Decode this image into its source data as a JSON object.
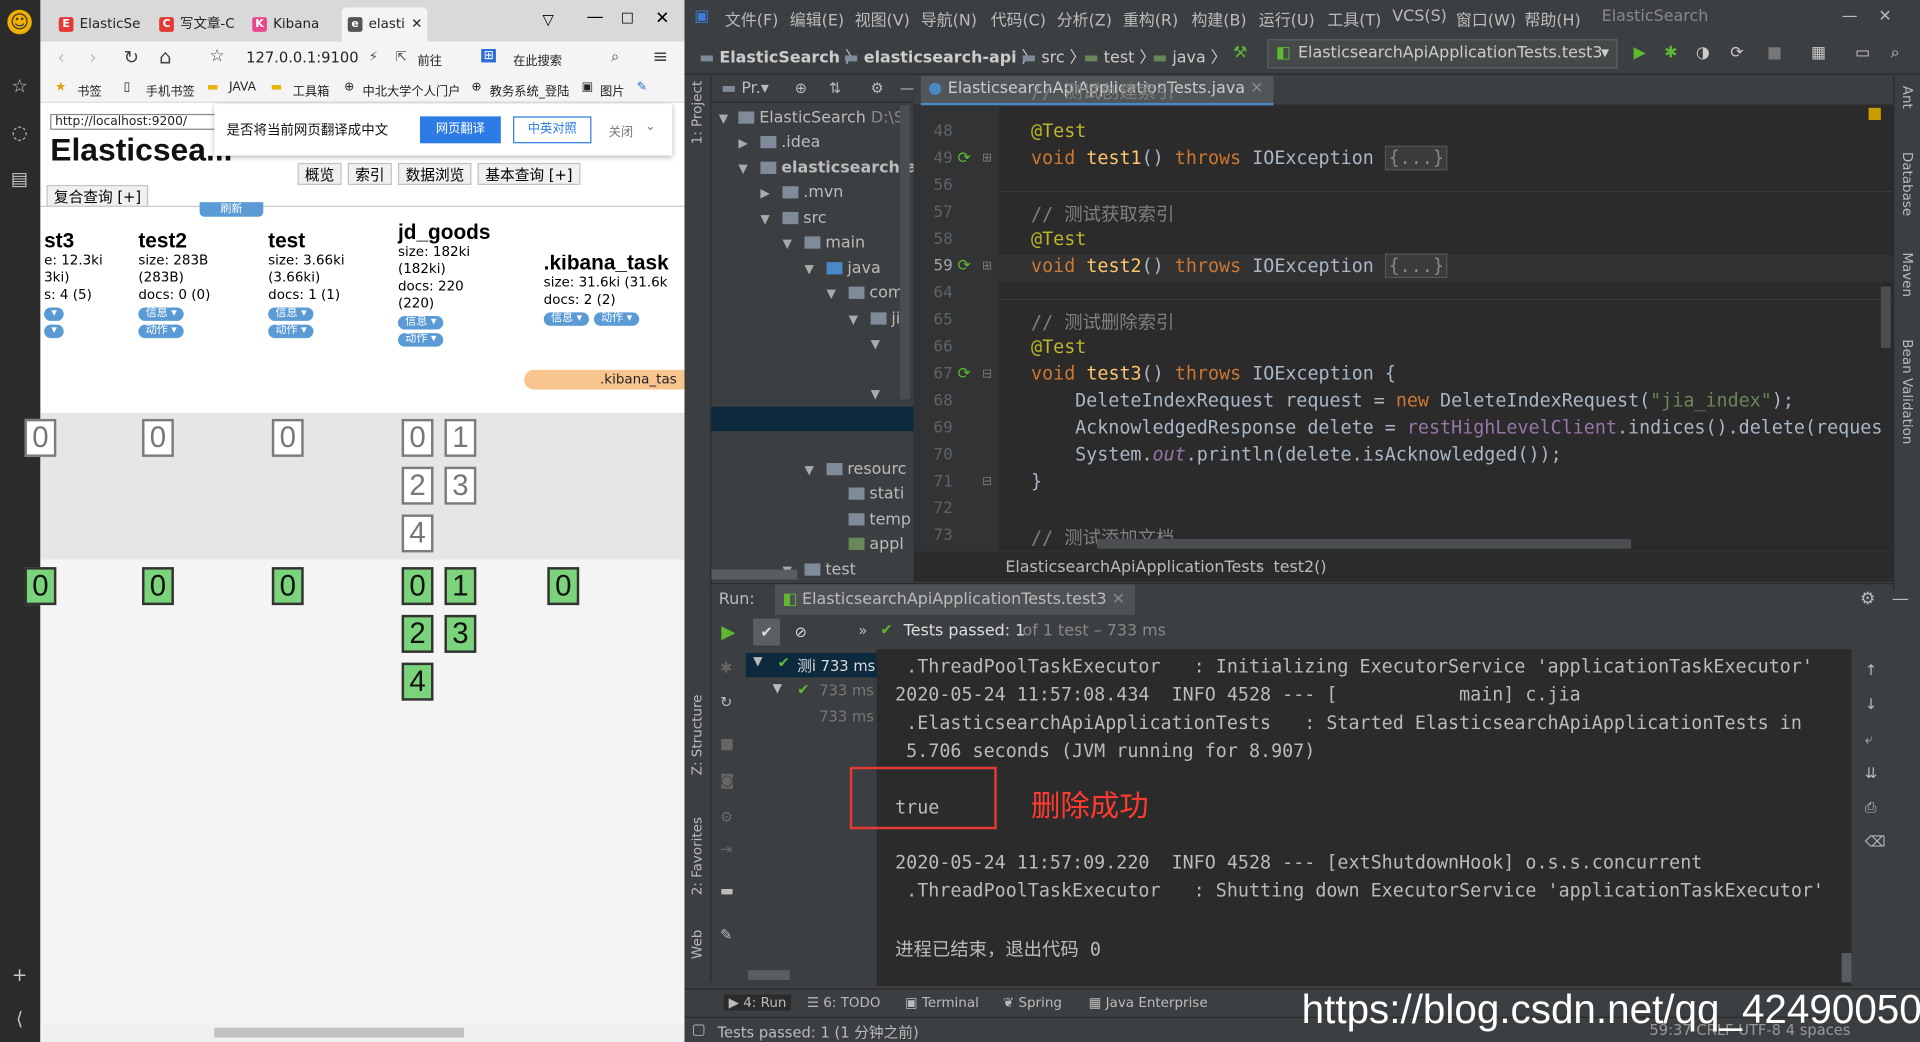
{
  "browser": {
    "tabs": [
      "ElasticSe",
      "写文章-C",
      "Kibana",
      "elasti"
    ],
    "address": "127.0.0.1:9100",
    "nav_extra": [
      "前往",
      "在此搜索"
    ],
    "bookmarks": [
      "书签",
      "手机书签",
      "JAVA",
      "工具箱",
      "中北大学个人门户",
      "教务系统_登陆",
      "图片"
    ],
    "translate": {
      "url": "http://localhost:9200/",
      "prompt": "是否将当前网页翻译成中文",
      "translate_btn": "网页翻译",
      "compare_btn": "中英对照",
      "close_btn": "关闭"
    },
    "title": "Elasticsea...",
    "tabs2": [
      "概览",
      "索引",
      "数据浏览",
      "基本查询 [+]"
    ],
    "compound_query": "复合查询 [+]",
    "refresh": "刷新",
    "indices": [
      {
        "name": "st3",
        "l1": "e: 12.3ki",
        "l2": "3ki)",
        "l3": "s: 4 (5)",
        "l4": ""
      },
      {
        "name": "test2",
        "l1": "size: 283B",
        "l2": "(283B)",
        "l3": "docs: 0 (0)",
        "l4": ""
      },
      {
        "name": "test",
        "l1": "size: 3.66ki",
        "l2": "(3.66ki)",
        "l3": "docs: 1 (1)",
        "l4": ""
      },
      {
        "name": "jd_goods",
        "l1": "size: 182ki",
        "l2": "(182ki)",
        "l3": "docs: 220",
        "l4": "(220)"
      },
      {
        "name": ".kibana_task",
        "l1": "size: 31.6ki (31.6k",
        "l2": "docs: 2 (2)",
        "l3": "",
        "l4": ""
      }
    ],
    "pill_info": "信息",
    "pill_action": "动作",
    "alias": ".kibana_tas",
    "shard_nums": [
      "0",
      "1",
      "2",
      "3",
      "4"
    ]
  },
  "ide": {
    "menu": [
      "文件(F)",
      "编辑(E)",
      "视图(V)",
      "导航(N)",
      "代码(C)",
      "分析(Z)",
      "重构(R)",
      "构建(B)",
      "运行(U)",
      "工具(T)",
      "VCS(S)",
      "窗口(W)",
      "帮助(H)",
      "ElasticSearch"
    ],
    "crumbs": [
      "ElasticSearch",
      "elasticsearch-api",
      "src",
      "test",
      "java"
    ],
    "run_config": "ElasticsearchApiApplicationTests.test3",
    "project_label": "Pr.",
    "project_tree": [
      {
        "label": "ElasticSearch",
        "extra": "D:\\S"
      },
      {
        "label": ".idea"
      },
      {
        "label": "elasticsearch-ap"
      },
      {
        "label": ".mvn"
      },
      {
        "label": "src"
      },
      {
        "label": "main"
      },
      {
        "label": "java"
      },
      {
        "label": "com"
      },
      {
        "label": "ji"
      },
      {
        "label": "resourc"
      },
      {
        "label": "stati"
      },
      {
        "label": "temp"
      },
      {
        "label": "appl"
      },
      {
        "label": "test"
      }
    ],
    "editor_tab": "ElasticsearchApiApplicationTests.java",
    "line_numbers": [
      "48",
      "49",
      "56",
      "57",
      "58",
      "59",
      "64",
      "65",
      "66",
      "67",
      "68",
      "69",
      "70",
      "71",
      "72",
      "73"
    ],
    "code": {
      "c1": "// 测试创建索引",
      "ann": "@Test",
      "void": "void",
      "t1": "test1",
      "t2": "test2",
      "t3": "test3",
      "throws": "throws",
      "ioe": "IOException",
      "folded": "{...}",
      "c2": "// 测试获取索引",
      "c3": "// 测试删除索引",
      "open": "{",
      "l68a": "DeleteIndexRequest request = ",
      "new": "new",
      "l68b": " DeleteIndexRequest(",
      "l68s": "\"jia_index\"",
      "l68c": ");",
      "l69a": "AcknowledgedResponse delete = ",
      "l69f": "restHighLevelClient",
      "l69b": ".indices().delete(reques",
      "l70a": "System.",
      "l70o": "out",
      "l70b": ".println(delete.isAcknowledged());",
      "close": "}",
      "c4": "// 测试添加文档"
    },
    "crumb_class": "ElasticsearchApiApplicationTests",
    "crumb_method": "test2()",
    "run_label": "Run:",
    "run_tab": "ElasticsearchApiApplicationTests.test3",
    "tests_passed": "Tests passed: 1",
    "tests_of": "of 1 test – 733 ms",
    "tree_node": "测i 733 ms",
    "tree_sub": "733 ms",
    "tree_sub2": "733 ms",
    "console": [
      " .ThreadPoolTaskExecutor   : Initializing ExecutorService 'applicationTaskExecutor'",
      "2020-05-24 11:57:08.434  INFO 4528 --- [           main] c.jia",
      " .ElasticsearchApiApplicationTests   : Started ElasticsearchApiApplicationTests in",
      " 5.706 seconds (JVM running for 8.907)",
      "true",
      "2020-05-24 11:57:09.220  INFO 4528 --- [extShutdownHook] o.s.s.concurrent",
      " .ThreadPoolTaskExecutor   : Shutting down ExecutorService 'applicationTaskExecutor'",
      "进程已结束，退出代码 0"
    ],
    "annotation": "删除成功",
    "left_tools": [
      "1: Project",
      "Z: Structure",
      "2: Favorites",
      "Web"
    ],
    "right_tools": [
      "Ant",
      "Database",
      "Maven",
      "Bean Validation"
    ],
    "bottom_tabs": [
      "4: Run",
      "6: TODO",
      "Terminal",
      "Spring",
      "Java Enterprise"
    ],
    "status": "Tests passed: 1 (1 分钟之前)",
    "status_right": "59:37  CRLF  UTF-8  4 spaces"
  },
  "watermark": "https://blog.csdn.net/qq_42490050",
  "colors": {
    "success": "#5fb832",
    "annotation": "#ff3b30",
    "shard_green": "#7bd47b"
  }
}
